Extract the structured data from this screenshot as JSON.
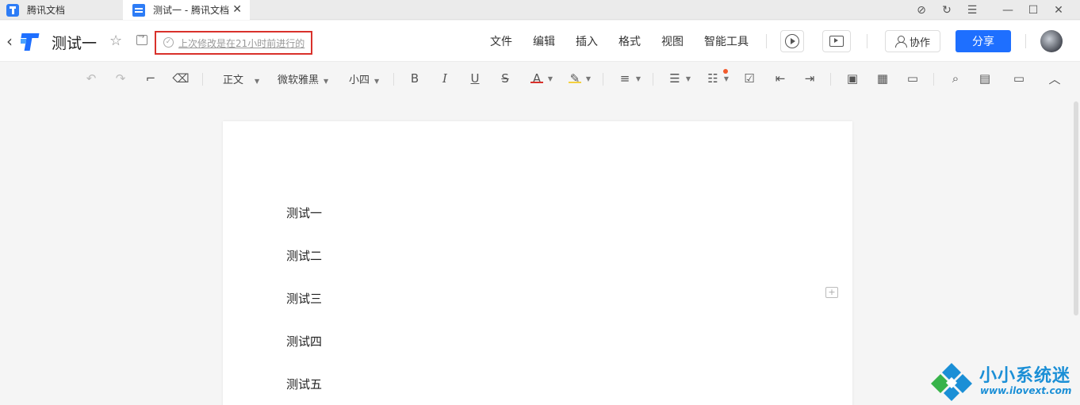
{
  "tabs": [
    {
      "label": "腾讯文档"
    },
    {
      "label": "测试一 - 腾讯文档"
    }
  ],
  "header": {
    "doc_title": "测试一",
    "save_status": "上次修改是在21小时前进行的",
    "menus": [
      "文件",
      "编辑",
      "插入",
      "格式",
      "视图",
      "智能工具"
    ],
    "collab_label": "协作",
    "share_label": "分享"
  },
  "toolbar": {
    "style_select": "正文",
    "font_select": "微软雅黑",
    "size_select": "小四"
  },
  "document": {
    "paragraphs": [
      "测试一",
      "测试二",
      "测试三",
      "测试四",
      "测试五"
    ]
  },
  "watermark": {
    "title": "小小系统迷",
    "url": "www.ilovext.com"
  },
  "colors": {
    "accent": "#1e6fff",
    "highlight_box": "#d9312b",
    "font_color_underline": "#d9312b",
    "highlight_underline": "#f4d03f"
  },
  "icons": {
    "tab_bar": [
      "tencent-docs-icon",
      "doc-icon",
      "close-icon",
      "compass-icon",
      "refresh-icon",
      "menu-icon",
      "minimize-icon",
      "maximize-icon",
      "window-close-icon"
    ],
    "header": [
      "back-icon",
      "logo-icon",
      "star-icon",
      "move-to-folder-icon",
      "check-circle-icon",
      "play-icon",
      "presentation-icon",
      "person-icon",
      "avatar"
    ],
    "toolbar": [
      "undo-icon",
      "redo-icon",
      "format-painter-icon",
      "eraser-icon",
      "bold-icon",
      "italic-icon",
      "underline-icon",
      "strikethrough-icon",
      "font-color-icon",
      "highlight-icon",
      "align-icon",
      "bullet-list-icon",
      "numbered-list-icon",
      "checkbox-icon",
      "outdent-icon",
      "indent-icon",
      "image-icon",
      "table-icon",
      "comment-icon",
      "find-icon",
      "outline-icon",
      "comments-panel-icon",
      "collapse-icon"
    ]
  }
}
